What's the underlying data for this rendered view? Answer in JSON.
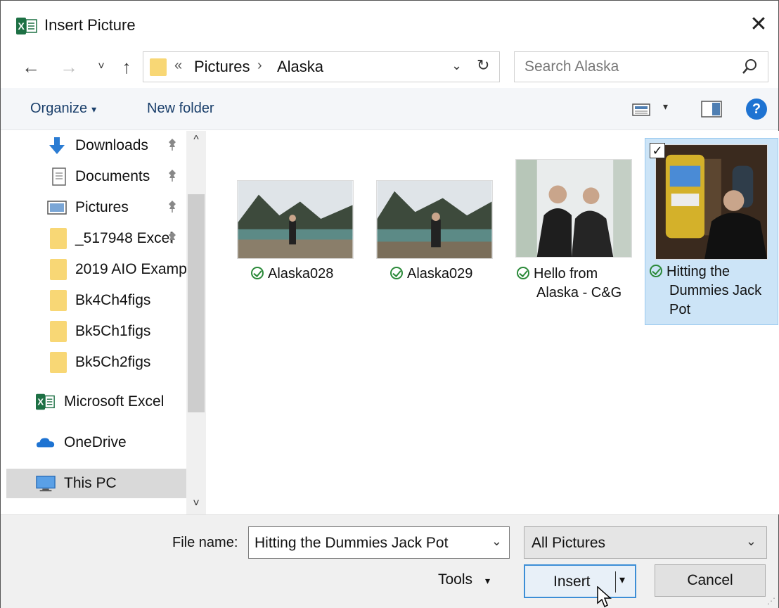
{
  "window": {
    "title": "Insert Picture",
    "close_glyph": "✕"
  },
  "nav": {
    "back_glyph": "←",
    "forward_glyph": "→",
    "recent_glyph": "˅",
    "up_glyph": "↑",
    "breadcrumb_prefix": "«",
    "breadcrumbs": [
      "Pictures",
      "Alaska"
    ],
    "breadcrumb_sep": "›",
    "dropdown_glyph": "⌄",
    "refresh_glyph": "↻",
    "search_placeholder": "Search Alaska"
  },
  "toolbar": {
    "organize_label": "Organize",
    "new_folder_label": "New folder",
    "help_label": "?"
  },
  "sidebar": {
    "items": [
      {
        "label": "Downloads",
        "icon": "download-arrow-icon",
        "pinned": true
      },
      {
        "label": "Documents",
        "icon": "document-icon",
        "pinned": true
      },
      {
        "label": "Pictures",
        "icon": "pictures-icon",
        "pinned": true
      },
      {
        "label": "_517948 Excel",
        "icon": "folder-icon",
        "pinned": true
      },
      {
        "label": "2019 AIO Examp",
        "icon": "folder-icon",
        "pinned": false
      },
      {
        "label": "Bk4Ch4figs",
        "icon": "folder-icon",
        "pinned": false
      },
      {
        "label": "Bk5Ch1figs",
        "icon": "folder-icon",
        "pinned": false
      },
      {
        "label": "Bk5Ch2figs",
        "icon": "folder-icon",
        "pinned": false
      },
      {
        "label": "Microsoft Excel",
        "icon": "excel-icon",
        "pinned": false
      },
      {
        "label": "OneDrive",
        "icon": "onedrive-cloud-icon",
        "pinned": false
      },
      {
        "label": "This PC",
        "icon": "monitor-icon",
        "pinned": false,
        "selected": true
      }
    ],
    "pin_glyph": "📌"
  },
  "files": [
    {
      "name_lines": [
        "Alaska028"
      ],
      "selected": false
    },
    {
      "name_lines": [
        "Alaska029"
      ],
      "selected": false
    },
    {
      "name_lines": [
        "Hello from",
        "Alaska - C&G"
      ],
      "selected": false
    },
    {
      "name_lines": [
        "Hitting the",
        "Dummies Jack",
        "Pot"
      ],
      "selected": true
    }
  ],
  "checkbox_glyph": "✓",
  "bottom": {
    "file_name_label": "File name:",
    "file_name_value": "Hitting the Dummies Jack Pot",
    "file_type_value": "All Pictures",
    "tools_label": "Tools",
    "insert_label": "Insert",
    "cancel_label": "Cancel",
    "caret_glyph": "▾",
    "chevron_glyph": "⌄"
  },
  "colors": {
    "accent": "#1e73d2",
    "selection": "#cce4f7",
    "folder": "#f8d775",
    "excel_green": "#1d7044"
  }
}
